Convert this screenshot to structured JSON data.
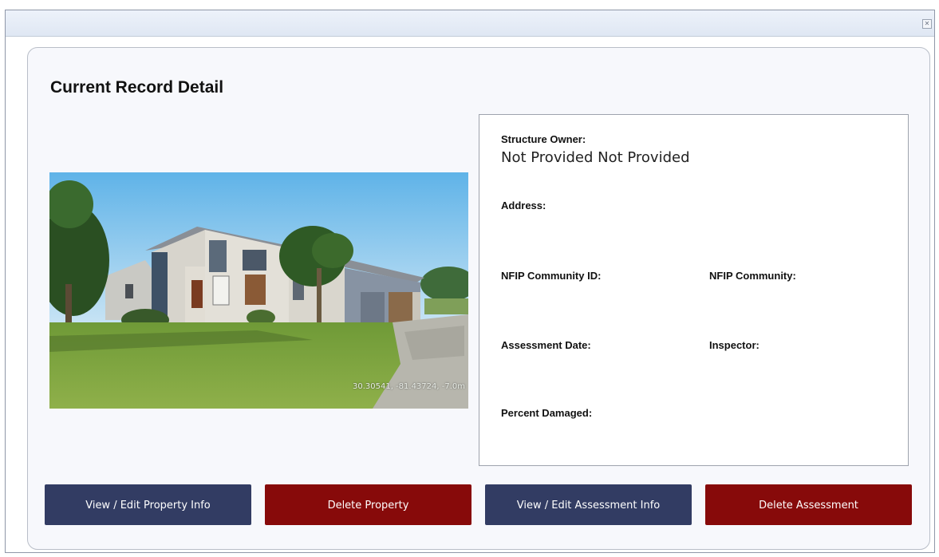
{
  "window": {
    "close_icon": "close-icon"
  },
  "panel": {
    "title": "Current Record Detail"
  },
  "photo": {
    "overlay_text": "30.30541, -81.43724, -7.0m"
  },
  "record": {
    "structure_owner_label": "Structure Owner:",
    "structure_owner_value": "Not Provided Not Provided",
    "address_label": "Address:",
    "address_value": "",
    "nfip_community_id_label": "NFIP Community ID:",
    "nfip_community_id_value": "",
    "nfip_community_label": "NFIP Community:",
    "nfip_community_value": "",
    "assessment_date_label": "Assessment Date:",
    "assessment_date_value": "",
    "inspector_label": "Inspector:",
    "inspector_value": "",
    "percent_damaged_label": "Percent Damaged:",
    "percent_damaged_value": ""
  },
  "actions": {
    "view_edit_property": "View / Edit Property Info",
    "delete_property": "Delete Property",
    "view_edit_assessment": "View / Edit Assessment Info",
    "delete_assessment": "Delete Assessment"
  },
  "colors": {
    "navy_button": "#323c63",
    "red_button": "#870a0a",
    "panel_background": "#f7f8fc"
  }
}
